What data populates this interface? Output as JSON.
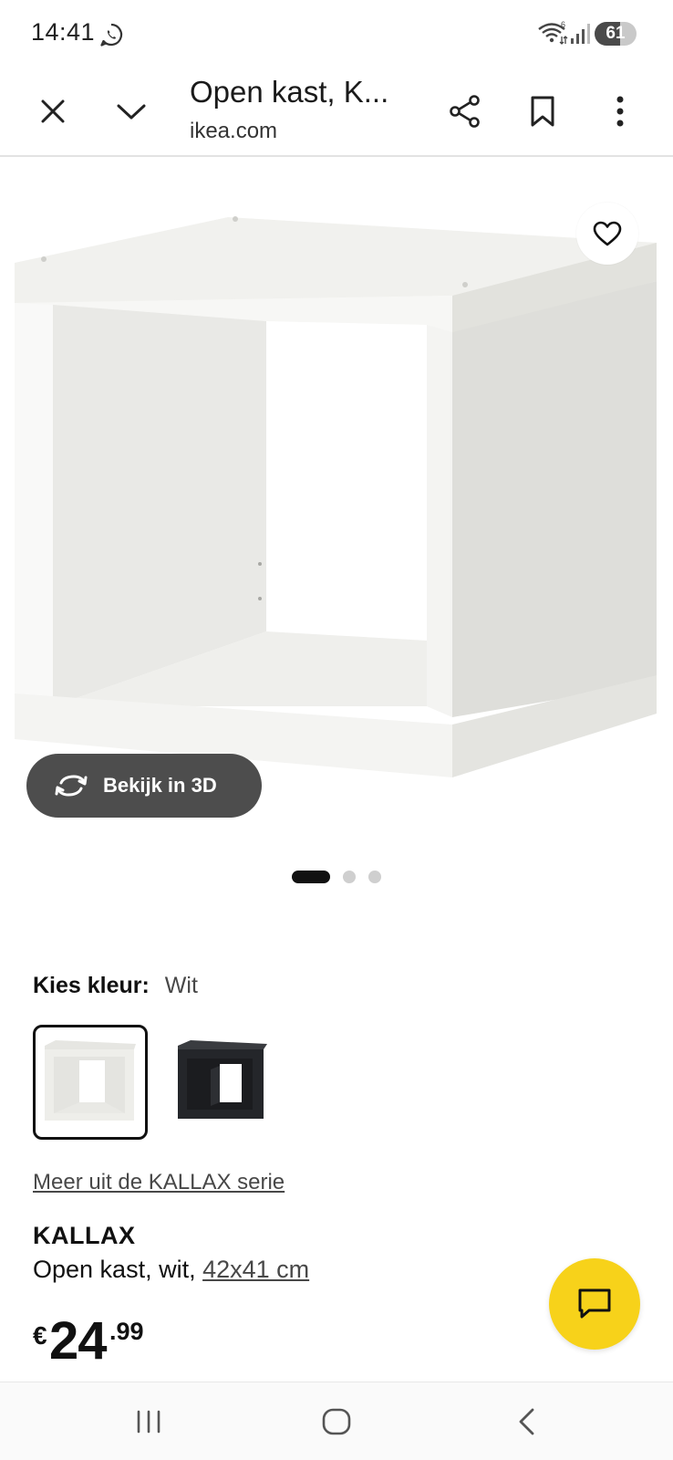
{
  "status_bar": {
    "time": "14:41",
    "battery": "61",
    "battery_level": 0.61,
    "icons": [
      "whatsapp-icon",
      "wifi-icon",
      "signal-icon",
      "battery-icon"
    ]
  },
  "toolbar": {
    "title": "Open kast, K...",
    "domain": "ikea.com",
    "icons": [
      "close-icon",
      "chevron-down-icon",
      "share-icon",
      "bookmark-icon",
      "more-vert-icon"
    ]
  },
  "product_image": {
    "view_3d_label": "Bekijk in 3D",
    "icons": [
      "heart-icon",
      "rotate-3d-icon"
    ],
    "carousel_total": 3,
    "carousel_active": 1
  },
  "color_picker": {
    "label": "Kies kleur:",
    "selected": "Wit",
    "swatch_colors": [
      "#eeeeea",
      "#24262a"
    ]
  },
  "product": {
    "series_link": "Meer uit de KALLAX serie",
    "name": "KALLAX",
    "description": "Open kast, wit, ",
    "size": "42x41 cm",
    "price_currency": "€",
    "price_integer": "24",
    "price_decimals": ".99"
  },
  "chat": {
    "icon": "chat-icon",
    "color": "#f7d21a"
  },
  "nav_bar": {
    "icons": [
      "recent-apps-icon",
      "home-icon",
      "back-icon"
    ]
  }
}
